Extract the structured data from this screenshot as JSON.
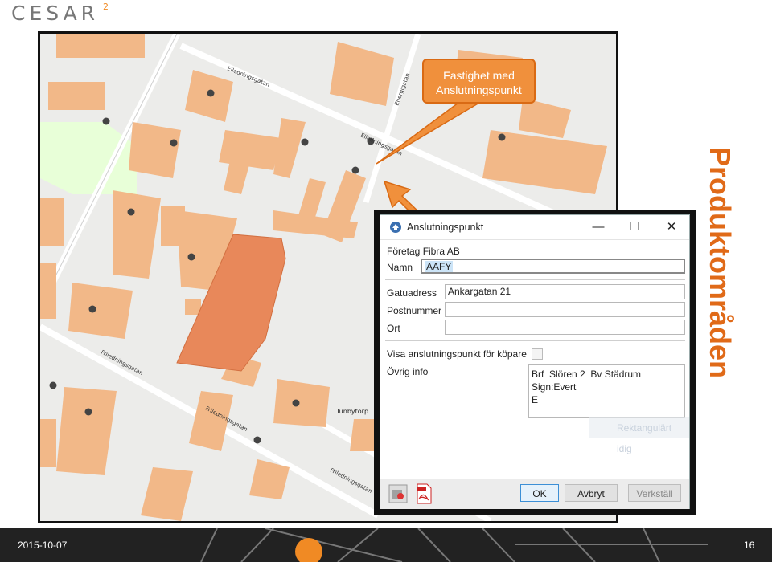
{
  "logo": {
    "text": "CESAR",
    "superscript": "2"
  },
  "side_title": "Produktområden",
  "callout": {
    "line1": "Fastighet med",
    "line2": "Anslutningspunkt"
  },
  "map": {
    "streets": [
      "Elledningsgatan",
      "Energigatan",
      "Elledningsgatan",
      "Friledningsgatan",
      "Friledningsgatan",
      "Friledningsgatan"
    ],
    "place": "Tunbytorp"
  },
  "dialog": {
    "title": "Anslutningspunkt",
    "company_label": "Företag Fibra AB",
    "name_label": "Namn",
    "name_value": "AAFY",
    "address_label": "Gatuadress",
    "address_value": "Ankargatan 21",
    "postnr_label": "Postnummer",
    "postnr_value": "",
    "city_label": "Ort",
    "city_value": "",
    "show_label": "Visa anslutningspunkt för köpare",
    "info_label": "Övrig info",
    "info_value": "Brf  Slören 2  Bv Städrum Sign:Evert\nE",
    "ok_label": "OK",
    "cancel_label": "Avbryt",
    "apply_label": "Verkställ",
    "minimize_glyph": "—",
    "maximize_glyph": "☐",
    "close_glyph": "✕"
  },
  "ghost_menu_item": "Rektangulärt idig",
  "footer": {
    "date": "2015-10-07",
    "page": "16"
  },
  "colors": {
    "building": "#f2b888",
    "highlight": "#e8885a",
    "accent": "#f08a24",
    "park": "#e8ffd8"
  }
}
